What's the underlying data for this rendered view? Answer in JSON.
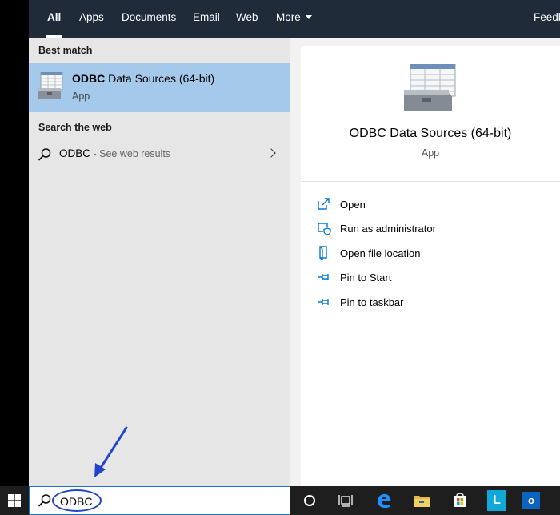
{
  "tabs": [
    {
      "label": "All"
    },
    {
      "label": "Apps"
    },
    {
      "label": "Documents"
    },
    {
      "label": "Email"
    },
    {
      "label": "Web"
    },
    {
      "label": "More"
    },
    {
      "label": "Feedb"
    }
  ],
  "left": {
    "best_match_title": "Best match",
    "best_item": {
      "name_bold": "ODBC",
      "name_rest": " Data Sources (64-bit)",
      "type": "App"
    },
    "web_title": "Search the web",
    "web_item": {
      "query": "ODBC",
      "suffix": " - See web results"
    }
  },
  "card": {
    "title": "ODBC Data Sources (64-bit)",
    "subtitle": "App"
  },
  "actions": [
    {
      "label": "Open",
      "icon": "open-icon"
    },
    {
      "label": "Run as administrator",
      "icon": "shield-icon"
    },
    {
      "label": "Open file location",
      "icon": "file-location-icon"
    },
    {
      "label": "Pin to Start",
      "icon": "pin-icon"
    },
    {
      "label": "Pin to taskbar",
      "icon": "pin-icon"
    }
  ],
  "search": {
    "value": "ODBC"
  },
  "taskbar": {
    "icons": [
      "windows-start-icon",
      "cortana-icon",
      "task-view-icon",
      "edge-icon",
      "file-explorer-icon",
      "store-icon",
      "launcher-l-icon",
      "outlook-icon"
    ],
    "launcher_letter": "L",
    "outlook_letter": "o"
  },
  "colors": {
    "topbar": "#1f2b39",
    "selection": "#a5c9ea",
    "accent": "#0078d7",
    "annotation": "#2045c8"
  }
}
